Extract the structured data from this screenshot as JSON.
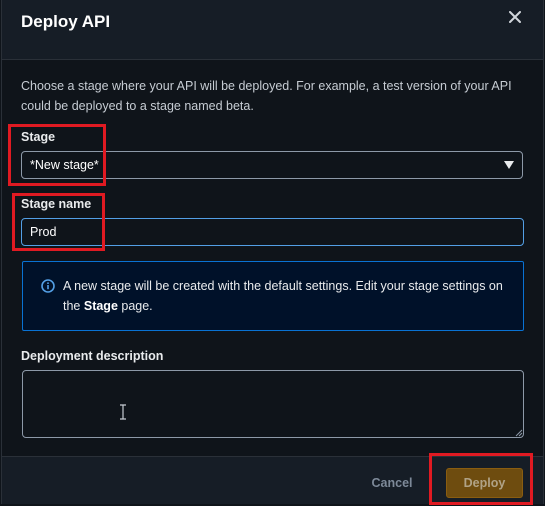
{
  "dialog": {
    "title": "Deploy API",
    "description": "Choose a stage where your API will be deployed. For example, a test version of your API could be deployed to a stage named beta."
  },
  "stage": {
    "label": "Stage",
    "selected": "*New stage*"
  },
  "stage_name": {
    "label": "Stage name",
    "value": "Prod"
  },
  "info": {
    "text_before": "A new stage will be created with the default settings. Edit your stage settings on the ",
    "bold": "Stage",
    "text_after": " page."
  },
  "deployment_description": {
    "label": "Deployment description",
    "value": ""
  },
  "footer": {
    "cancel_label": "Cancel",
    "deploy_label": "Deploy"
  },
  "colors": {
    "background": "#0f141a",
    "header": "#161d26",
    "info_border": "#0972d3",
    "input_focus": "#539fe5",
    "primary_button": "#6e4c0f",
    "highlight": "#e01a22"
  },
  "icons": [
    "close-icon",
    "caret-down-icon",
    "info-icon",
    "text-cursor-icon",
    "resize-grip-icon"
  ]
}
